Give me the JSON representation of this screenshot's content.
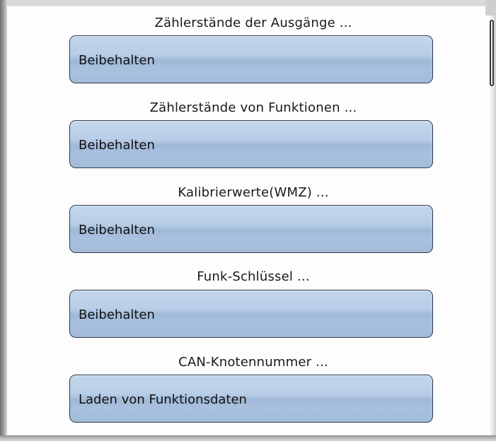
{
  "settings": [
    {
      "heading": "Zählerstände der Ausgänge ...",
      "value": "Beibehalten"
    },
    {
      "heading": "Zählerstände von Funktionen ...",
      "value": "Beibehalten"
    },
    {
      "heading": "Kalibrierwerte(WMZ) ...",
      "value": "Beibehalten"
    },
    {
      "heading": "Funk-Schlüssel ...",
      "value": "Beibehalten"
    },
    {
      "heading": "CAN-Knotennummer ...",
      "value": "Laden von Funktionsdaten"
    }
  ],
  "colors": {
    "button_fill": "#b0c6e1",
    "button_border": "#2b3a4a",
    "background": "#fdfdfd"
  }
}
